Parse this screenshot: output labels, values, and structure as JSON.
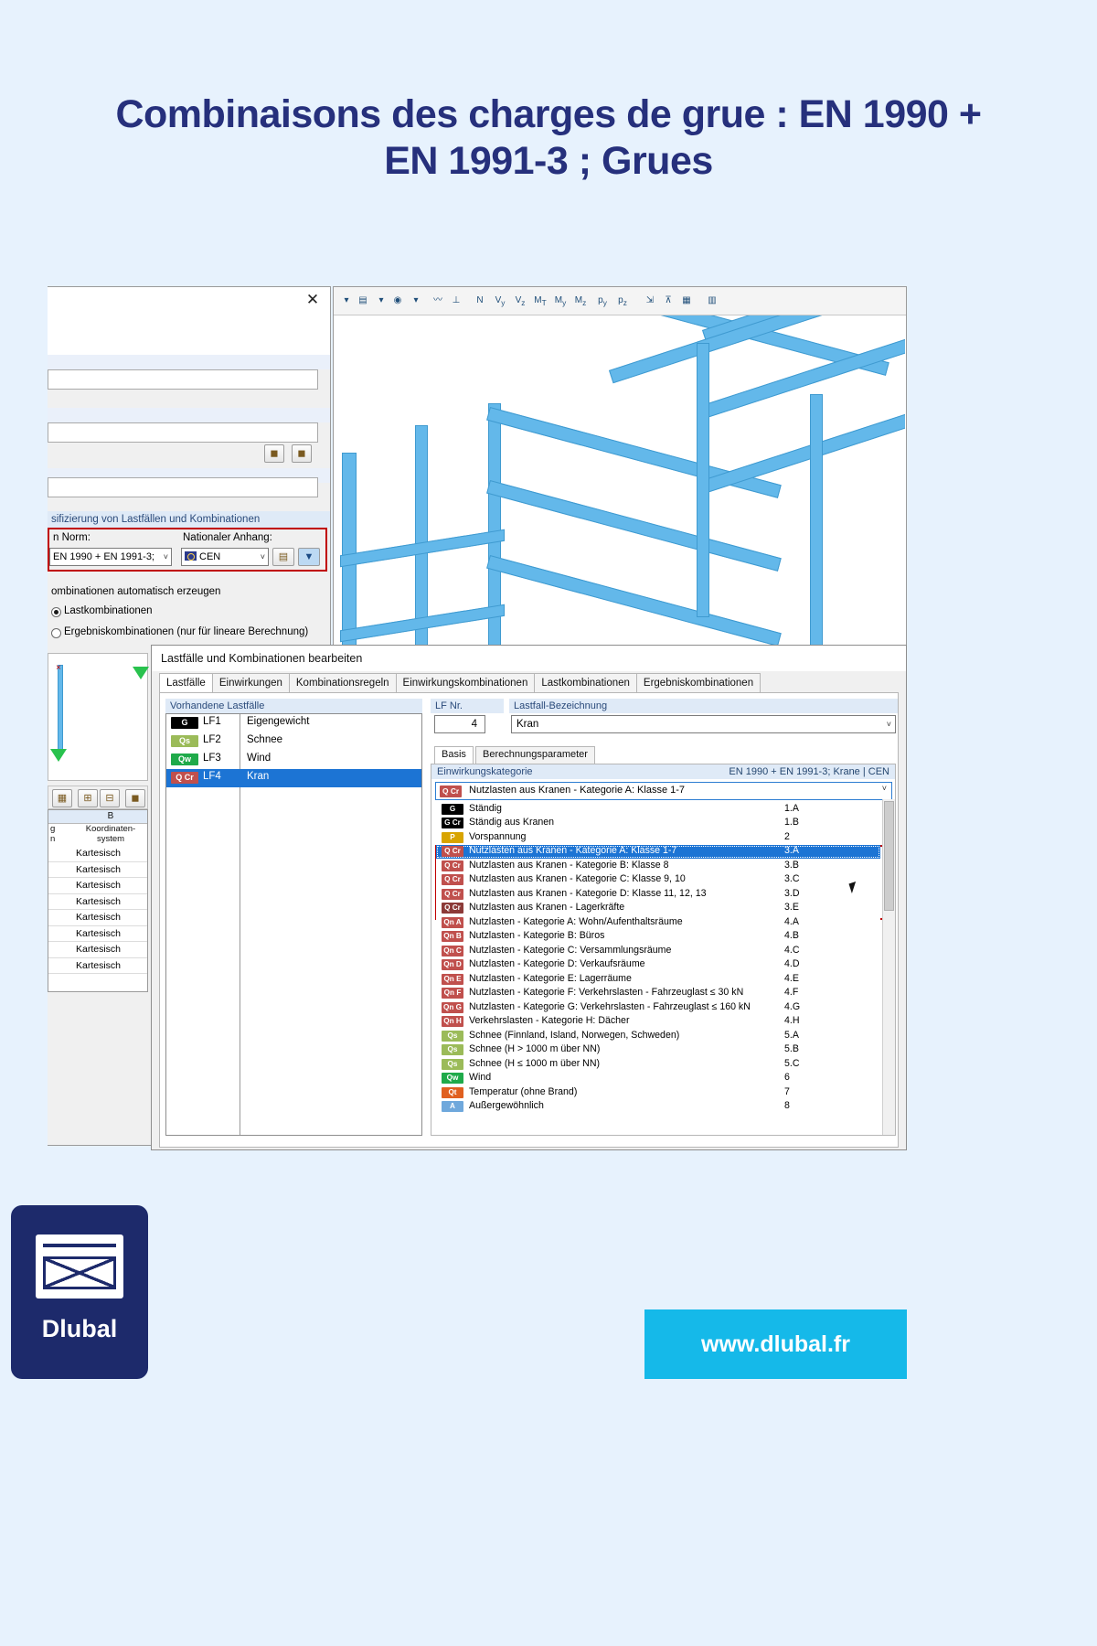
{
  "page": {
    "title": "Combinaisons des charges de grue : EN 1990 + EN 1991-3 ; Grues",
    "background_color": "#e7f2fd",
    "title_color": "#26307c"
  },
  "branding": {
    "logo_text": "Dlubal",
    "url": "www.dlubal.fr",
    "url_box_color": "#15b9e9",
    "logo_color": "#1d2a6b"
  },
  "dialog_left": {
    "close_label": "✕",
    "section_header": "sifizierung von Lastfällen und Kombinationen",
    "norm_label": "n Norm:",
    "annex_label": "Nationaler Anhang:",
    "norm_value": "EN 1990 + EN 1991-3;",
    "annex_value": "CEN",
    "auto_generate_label": "ombinationen automatisch erzeugen",
    "radio_1": "Lastkombinationen",
    "radio_2": "Ergebniskombinationen (nur für lineare Berechnung)",
    "highlight_color": "#c00000"
  },
  "dialog_main": {
    "title": "Lastfälle und Kombinationen bearbeiten",
    "tabs": [
      {
        "label": "Lastfälle",
        "selected": true
      },
      {
        "label": "Einwirkungen",
        "selected": false
      },
      {
        "label": "Kombinationsregeln",
        "selected": false
      },
      {
        "label": "Einwirkungskombinationen",
        "selected": false
      },
      {
        "label": "Lastkombinationen",
        "selected": false
      },
      {
        "label": "Ergebniskombinationen",
        "selected": false
      }
    ],
    "load_cases_caption": "Vorhandene Lastfälle",
    "load_cases": [
      {
        "tag": "G",
        "tag_color": "#000000",
        "no": "LF1",
        "name": "Eigengewicht",
        "selected": false
      },
      {
        "tag": "Qs",
        "tag_color": "#9bbb59",
        "no": "LF2",
        "name": "Schnee",
        "selected": false
      },
      {
        "tag": "Qw",
        "tag_color": "#1faa4a",
        "no": "LF3",
        "name": "Wind",
        "selected": false
      },
      {
        "tag": "Q Cr",
        "tag_color": "#c0504d",
        "no": "LF4",
        "name": "Kran",
        "selected": true
      }
    ],
    "lf_nr_caption": "LF Nr.",
    "lf_nr_value": "4",
    "lf_name_caption": "Lastfall-Bezeichnung",
    "lf_name_value": "Kran",
    "sub_tabs": [
      {
        "label": "Basis",
        "selected": true
      },
      {
        "label": "Berechnungsparameter",
        "selected": false
      }
    ],
    "category_caption": "Einwirkungskategorie",
    "category_standard": "EN 1990 + EN 1991-3; Krane | CEN",
    "category_selected": {
      "tag": "Q Cr",
      "tag_color": "#c0504d",
      "label": "Nutzlasten aus Kranen - Kategorie A: Klasse 1-7"
    },
    "category_items": [
      {
        "tag": "G",
        "tag_color": "#000000",
        "label": "Ständig",
        "code": "1.A",
        "selected": false,
        "boxed": false
      },
      {
        "tag": "G Cr",
        "tag_color": "#000000",
        "label": "Ständig aus Kranen",
        "code": "1.B",
        "selected": false,
        "boxed": false
      },
      {
        "tag": "P",
        "tag_color": "#d8a400",
        "label": "Vorspannung",
        "code": "2",
        "selected": false,
        "boxed": false
      },
      {
        "tag": "Q Cr",
        "tag_color": "#c0504d",
        "label": "Nutzlasten aus Kranen - Kategorie A: Klasse 1-7",
        "code": "3.A",
        "selected": true,
        "boxed": true
      },
      {
        "tag": "Q Cr",
        "tag_color": "#c0504d",
        "label": "Nutzlasten aus Kranen - Kategorie B: Klasse 8",
        "code": "3.B",
        "selected": false,
        "boxed": true
      },
      {
        "tag": "Q Cr",
        "tag_color": "#c0504d",
        "label": "Nutzlasten aus Kranen - Kategorie C: Klasse 9, 10",
        "code": "3.C",
        "selected": false,
        "boxed": true
      },
      {
        "tag": "Q Cr",
        "tag_color": "#c0504d",
        "label": "Nutzlasten aus Kranen - Kategorie D: Klasse 11, 12, 13",
        "code": "3.D",
        "selected": false,
        "boxed": true
      },
      {
        "tag": "Q Cr",
        "tag_color": "#8c3a38",
        "label": "Nutzlasten aus Kranen - Lagerkräfte",
        "code": "3.E",
        "selected": false,
        "boxed": true
      },
      {
        "tag": "Qn A",
        "tag_color": "#c0504d",
        "label": "Nutzlasten - Kategorie A: Wohn/Aufenthaltsräume",
        "code": "4.A",
        "selected": false,
        "boxed": false
      },
      {
        "tag": "Qn B",
        "tag_color": "#c0504d",
        "label": "Nutzlasten - Kategorie B: Büros",
        "code": "4.B",
        "selected": false,
        "boxed": false
      },
      {
        "tag": "Qn C",
        "tag_color": "#c0504d",
        "label": "Nutzlasten - Kategorie C: Versammlungsräume",
        "code": "4.C",
        "selected": false,
        "boxed": false
      },
      {
        "tag": "Qn D",
        "tag_color": "#c0504d",
        "label": "Nutzlasten - Kategorie D: Verkaufsräume",
        "code": "4.D",
        "selected": false,
        "boxed": false
      },
      {
        "tag": "Qn E",
        "tag_color": "#c0504d",
        "label": "Nutzlasten - Kategorie E: Lagerräume",
        "code": "4.E",
        "selected": false,
        "boxed": false
      },
      {
        "tag": "Qn F",
        "tag_color": "#c0504d",
        "label": "Nutzlasten - Kategorie F: Verkehrslasten - Fahrzeuglast ≤ 30 kN",
        "code": "4.F",
        "selected": false,
        "boxed": false
      },
      {
        "tag": "Qn G",
        "tag_color": "#c0504d",
        "label": "Nutzlasten - Kategorie G: Verkehrslasten - Fahrzeuglast ≤ 160 kN",
        "code": "4.G",
        "selected": false,
        "boxed": false
      },
      {
        "tag": "Qn H",
        "tag_color": "#c0504d",
        "label": "Verkehrslasten - Kategorie H: Dächer",
        "code": "4.H",
        "selected": false,
        "boxed": false
      },
      {
        "tag": "Qs",
        "tag_color": "#9bbb59",
        "label": "Schnee (Finnland, Island, Norwegen, Schweden)",
        "code": "5.A",
        "selected": false,
        "boxed": false
      },
      {
        "tag": "Qs",
        "tag_color": "#9bbb59",
        "label": "Schnee (H > 1000 m über NN)",
        "code": "5.B",
        "selected": false,
        "boxed": false
      },
      {
        "tag": "Qs",
        "tag_color": "#9bbb59",
        "label": "Schnee (H ≤ 1000 m über NN)",
        "code": "5.C",
        "selected": false,
        "boxed": false
      },
      {
        "tag": "Qw",
        "tag_color": "#1faa4a",
        "label": "Wind",
        "code": "6",
        "selected": false,
        "boxed": false
      },
      {
        "tag": "Qt",
        "tag_color": "#e06020",
        "label": "Temperatur (ohne Brand)",
        "code": "7",
        "selected": false,
        "boxed": false
      },
      {
        "tag": "A",
        "tag_color": "#6fa8dc",
        "label": "Außergewöhnlich",
        "code": "8",
        "selected": false,
        "boxed": false
      }
    ]
  },
  "spreadsheet": {
    "col_b": "B",
    "header_left": "g\nn",
    "header_b": "Koordinaten-system",
    "rows": [
      "Kartesisch",
      "Kartesisch",
      "Kartesisch",
      "Kartesisch",
      "Kartesisch",
      "Kartesisch",
      "Kartesisch",
      "Kartesisch"
    ]
  }
}
